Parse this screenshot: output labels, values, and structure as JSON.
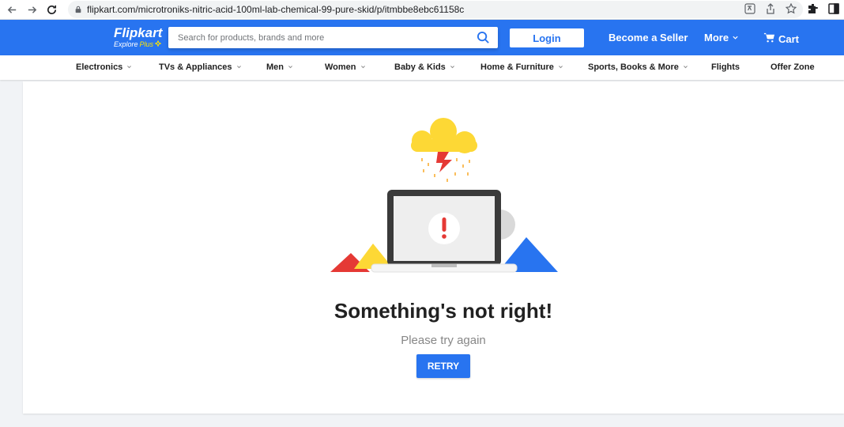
{
  "browser": {
    "url": "flipkart.com/microtroniks-nitric-acid-100ml-lab-chemical-99-pure-skid/p/itmbbe8ebc61158c"
  },
  "header": {
    "logo_text": "Flipkart",
    "logo_sub_text": "Explore",
    "logo_sub_plus": "Plus",
    "search_placeholder": "Search for products, brands and more",
    "login_label": "Login",
    "seller_label": "Become a Seller",
    "more_label": "More",
    "cart_label": "Cart"
  },
  "categories": [
    {
      "label": "Electronics",
      "dropdown": true
    },
    {
      "label": "TVs & Appliances",
      "dropdown": true
    },
    {
      "label": "Men",
      "dropdown": true
    },
    {
      "label": "Women",
      "dropdown": true
    },
    {
      "label": "Baby & Kids",
      "dropdown": true
    },
    {
      "label": "Home & Furniture",
      "dropdown": true
    },
    {
      "label": "Sports, Books & More",
      "dropdown": true
    },
    {
      "label": "Flights",
      "dropdown": false
    },
    {
      "label": "Offer Zone",
      "dropdown": false
    }
  ],
  "error": {
    "title": "Something's not right!",
    "subtitle": "Please try again",
    "retry_label": "RETRY"
  },
  "colors": {
    "brand_blue": "#2874f0",
    "logo_yellow": "#ffe500",
    "alert_red": "#e53935",
    "cloud_yellow": "#fdd835"
  }
}
